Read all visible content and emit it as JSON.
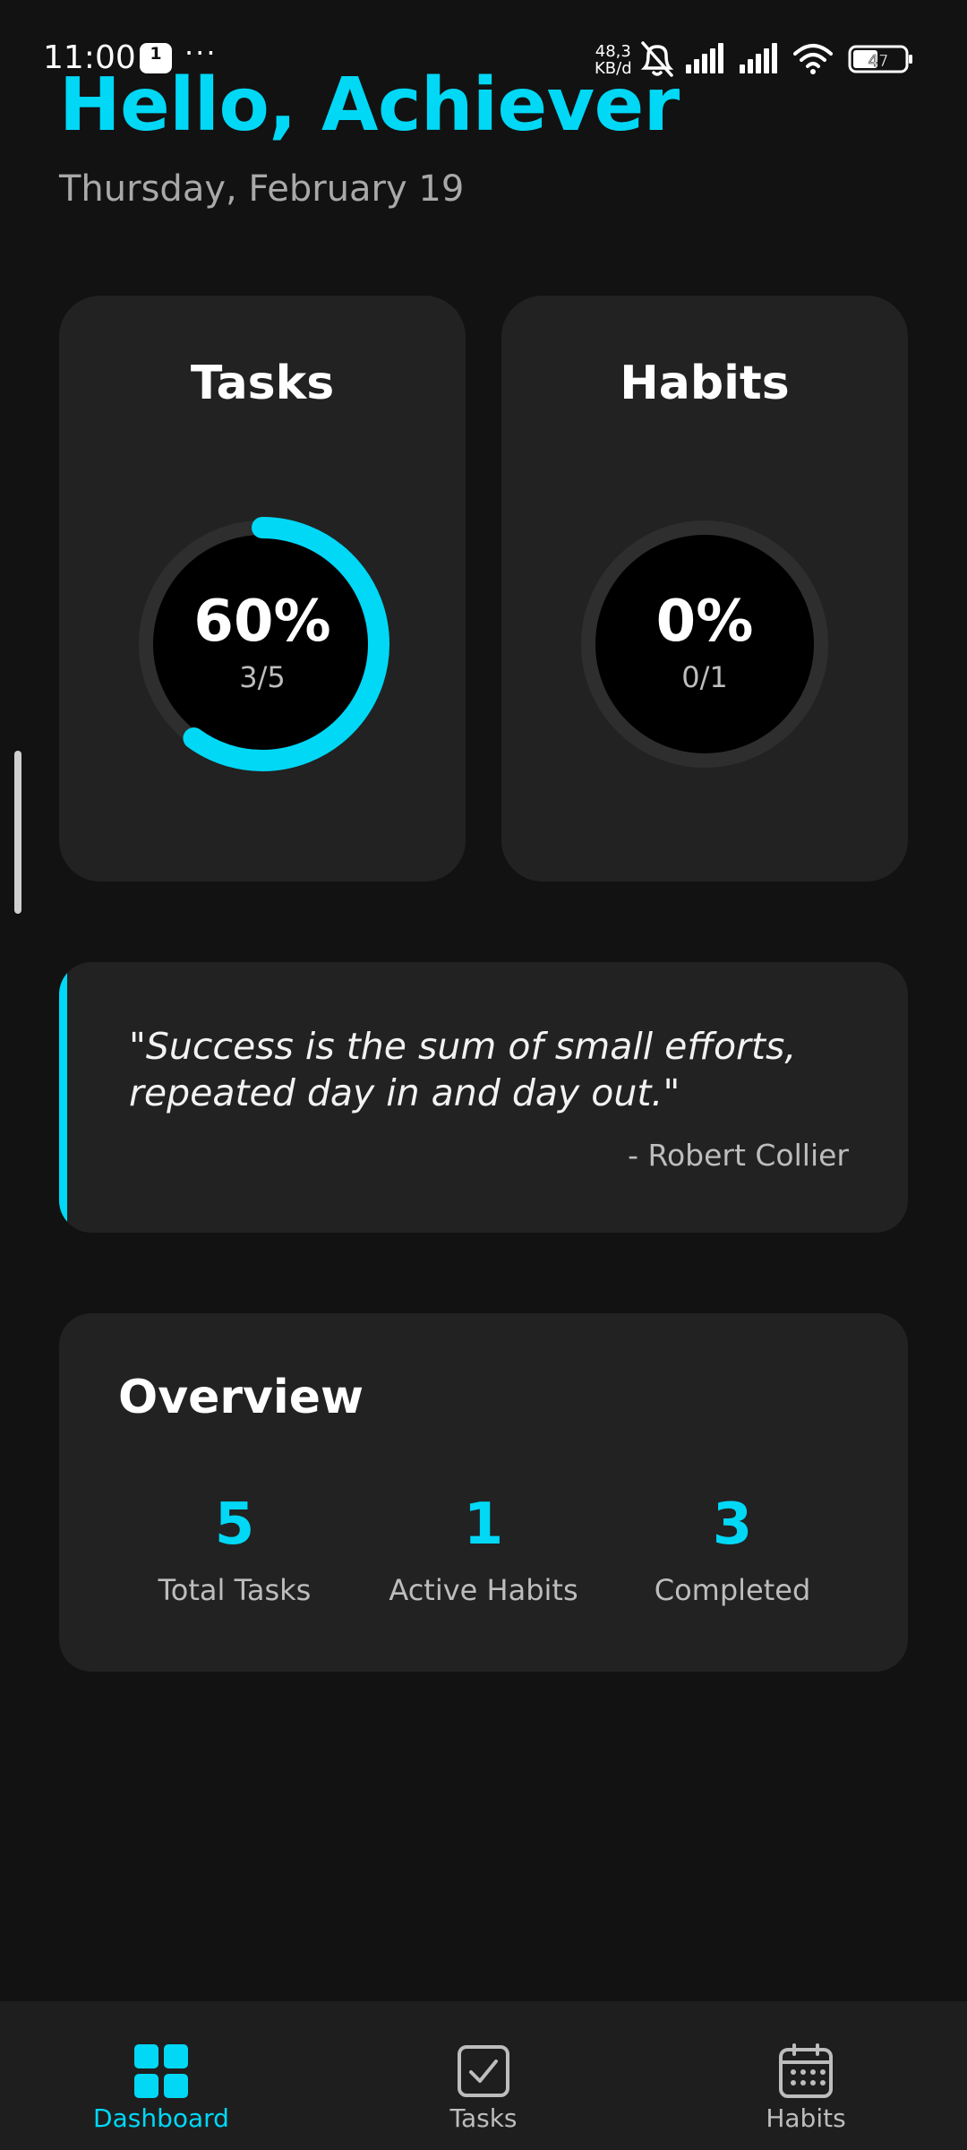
{
  "status_bar": {
    "time": "11:00",
    "calendar_day": "1",
    "more": "···",
    "net_speed_value": "48,3",
    "net_speed_unit": "KB/d",
    "battery": "47",
    "icons": [
      "calendar-icon",
      "mute-bell-icon",
      "signal-icon",
      "signal-icon",
      "wifi-icon",
      "battery-icon"
    ]
  },
  "header": {
    "greeting": "Hello, Achiever",
    "date": "Thursday, February 19"
  },
  "progress_cards": [
    {
      "title": "Tasks",
      "percent_label": "60%",
      "count_label": "3/5",
      "progress": 0.6
    },
    {
      "title": "Habits",
      "percent_label": "0%",
      "count_label": "0/1",
      "progress": 0.0
    }
  ],
  "quote": {
    "text": "\"Success is the sum of small efforts, repeated day in and day out.\"",
    "author": "- Robert Collier"
  },
  "overview": {
    "title": "Overview",
    "stats": [
      {
        "value": "5",
        "label": "Total Tasks"
      },
      {
        "value": "1",
        "label": "Active Habits"
      },
      {
        "value": "3",
        "label": "Completed"
      }
    ]
  },
  "bottom_nav": {
    "items": [
      {
        "label": "Dashboard",
        "icon": "grid-icon",
        "active": true
      },
      {
        "label": "Tasks",
        "icon": "checkbox-icon",
        "active": false
      },
      {
        "label": "Habits",
        "icon": "calendar-icon",
        "active": false
      }
    ]
  },
  "colors": {
    "accent": "#00d8f6",
    "background": "#121212",
    "card": "#222222",
    "ring_track": "#2e2e2e"
  }
}
